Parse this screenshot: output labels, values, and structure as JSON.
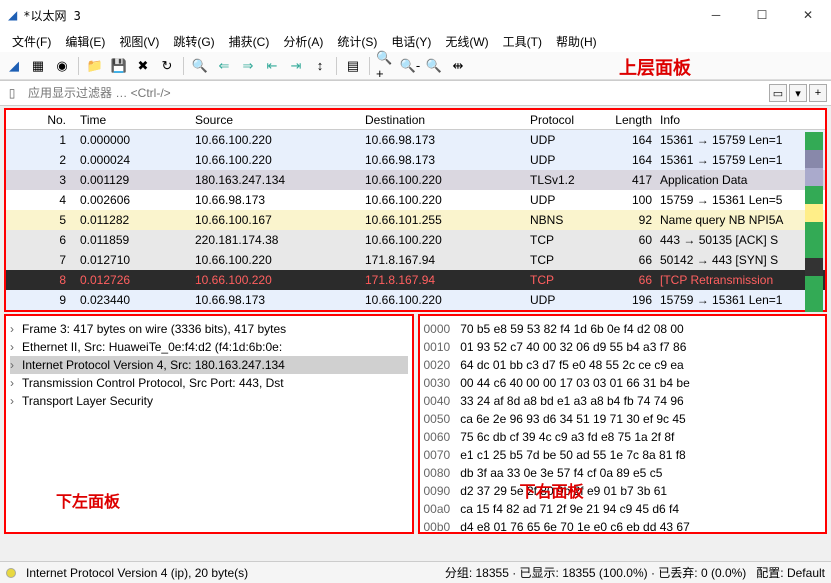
{
  "window": {
    "title": "*以太网 3"
  },
  "menu": {
    "file": "文件(F)",
    "edit": "编辑(E)",
    "view": "视图(V)",
    "go": "跳转(G)",
    "capture": "捕获(C)",
    "analyze": "分析(A)",
    "stats": "统计(S)",
    "telephony": "电话(Y)",
    "wireless": "无线(W)",
    "tools": "工具(T)",
    "help": "帮助(H)"
  },
  "annotations": {
    "top": "上层面板",
    "bl": "下左面板",
    "br": "下右面板"
  },
  "filter": {
    "placeholder": "应用显示过滤器 … <Ctrl-/>"
  },
  "headers": {
    "no": "No.",
    "time": "Time",
    "src": "Source",
    "dst": "Destination",
    "proto": "Protocol",
    "len": "Length",
    "info": "Info"
  },
  "rows": [
    {
      "no": "1",
      "time": "0.000000",
      "src": "10.66.100.220",
      "dst": "10.66.98.173",
      "proto": "UDP",
      "len": "164",
      "info": "15361 → 15759 Len=1",
      "cls": "r-blue"
    },
    {
      "no": "2",
      "time": "0.000024",
      "src": "10.66.100.220",
      "dst": "10.66.98.173",
      "proto": "UDP",
      "len": "164",
      "info": "15361 → 15759 Len=1",
      "cls": "r-blue"
    },
    {
      "no": "3",
      "time": "0.001129",
      "src": "180.163.247.134",
      "dst": "10.66.100.220",
      "proto": "TLSv1.2",
      "len": "417",
      "info": "Application Data",
      "cls": "r-gray"
    },
    {
      "no": "4",
      "time": "0.002606",
      "src": "10.66.98.173",
      "dst": "10.66.100.220",
      "proto": "UDP",
      "len": "100",
      "info": "15759 → 15361 Len=5",
      "cls": "r-white"
    },
    {
      "no": "5",
      "time": "0.011282",
      "src": "10.66.100.167",
      "dst": "10.66.101.255",
      "proto": "NBNS",
      "len": "92",
      "info": "Name query NB NPI5A",
      "cls": "r-yellow"
    },
    {
      "no": "6",
      "time": "0.011859",
      "src": "220.181.174.38",
      "dst": "10.66.100.220",
      "proto": "TCP",
      "len": "60",
      "info": "443 → 50135 [ACK] S",
      "cls": "r-lgray"
    },
    {
      "no": "7",
      "time": "0.012710",
      "src": "10.66.100.220",
      "dst": "171.8.167.94",
      "proto": "TCP",
      "len": "66",
      "info": "50142 → 443 [SYN] S",
      "cls": "r-lgray"
    },
    {
      "no": "8",
      "time": "0.012726",
      "src": "10.66.100.220",
      "dst": "171.8.167.94",
      "proto": "TCP",
      "len": "66",
      "info": "[TCP Retransmission",
      "cls": "r-dark"
    },
    {
      "no": "9",
      "time": "0.023440",
      "src": "10.66.98.173",
      "dst": "10.66.100.220",
      "proto": "UDP",
      "len": "196",
      "info": "15759 → 15361 Len=1",
      "cls": "r-blue"
    }
  ],
  "tree": [
    {
      "t": "Frame 3: 417 bytes on wire (3336 bits), 417 bytes"
    },
    {
      "t": "Ethernet II, Src: HuaweiTe_0e:f4:d2 (f4:1d:6b:0e:"
    },
    {
      "t": "Internet Protocol Version 4, Src: 180.163.247.134",
      "hl": true
    },
    {
      "t": "Transmission Control Protocol, Src Port: 443, Dst"
    },
    {
      "t": "Transport Layer Security"
    }
  ],
  "hex": [
    {
      "o": "0000",
      "b": "70 b5 e8 59 53 82 f4 1d  6b 0e f4 d2 08 00"
    },
    {
      "o": "0010",
      "b": "01 93 52 c7 40 00 32 06  d9 55 b4 a3 f7 86"
    },
    {
      "o": "0020",
      "b": "64 dc 01 bb c3 d7 f5 e0  48 55 2c ce c9 ea"
    },
    {
      "o": "0030",
      "b": "00 44 c6 40 00 00 17 03  03 01 66 31 b4 be"
    },
    {
      "o": "0040",
      "b": "33 24 af 8d a8 bd e1 a3  a8 b4 fb 74 74 96"
    },
    {
      "o": "0050",
      "b": "ca 6e 2e 96 93 d6 34 51  19 71 30 ef 9c 45"
    },
    {
      "o": "0060",
      "b": "75 6c db cf 39 4c c9 a3  fd e8 75 1a 2f 8f"
    },
    {
      "o": "0070",
      "b": "e1 c1 25 b5 7d be 50 ad  55 1e 7c 8a 81 f8"
    },
    {
      "o": "0080",
      "b": "db 3f aa 33 0e 3e 57 f4  cf 0a 89 e5 c5"
    },
    {
      "o": "0090",
      "b": "d2 37 29 5e 2f 80 9b  2f e9 01 b7 3b 61"
    },
    {
      "o": "00a0",
      "b": "ca 15 f4 82 ad 71 2f 9e  21 94 c9 45 d6 f4"
    },
    {
      "o": "00b0",
      "b": "d4 e8 01 76 65 6e 70 1e  e0 c6 eb dd 43 67"
    }
  ],
  "status": {
    "proto": "Internet Protocol Version 4 (ip), 20 byte(s)",
    "pkts": "分组: 18355 · 已显示: 18355 (100.0%) · 已丢弃: 0 (0.0%)",
    "profile": "配置: Default"
  }
}
